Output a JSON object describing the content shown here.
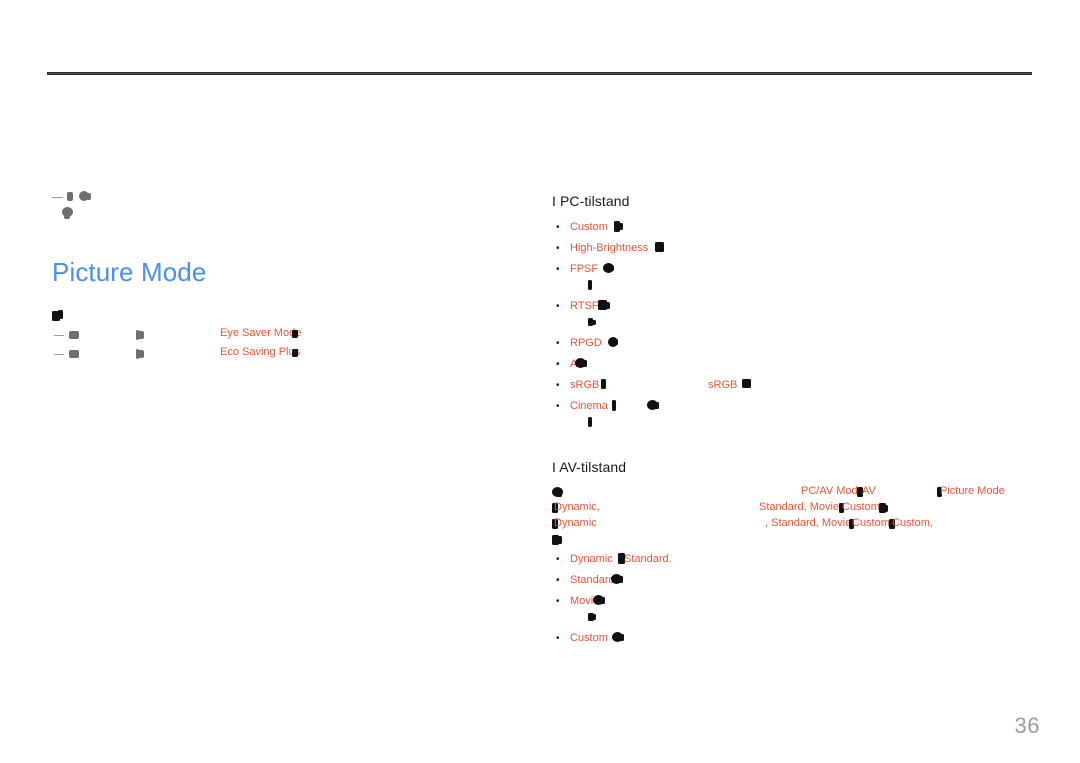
{
  "document": {
    "page_number": "36",
    "title": "Picture Mode",
    "title_color": "#4a8ef0",
    "term_color": "#e8543a",
    "heading_color": "#1a1a1a",
    "page_number_color": "#9b9b9b"
  },
  "left_column": {
    "title": "Picture Mode",
    "option_rows": [
      {
        "term": "Eye Saver Mode"
      },
      {
        "term": "Eco Saving Plus"
      }
    ]
  },
  "right_column": {
    "pc_section": {
      "heading": "I PC-tilstand",
      "bullets": [
        {
          "term": "Custom",
          "has_continuation": false
        },
        {
          "term": "High-Brightness",
          "has_continuation": false
        },
        {
          "term": "FPSF",
          "has_continuation": true
        },
        {
          "term": "RTSF",
          "has_continuation": true
        },
        {
          "term": "RPGD",
          "has_continuation": false
        },
        {
          "term": "AO",
          "has_continuation": false
        },
        {
          "term": "sRGB",
          "second_term": "sRGB",
          "has_continuation": false
        },
        {
          "term": "Cinema",
          "has_continuation": true
        }
      ]
    },
    "av_section": {
      "heading": "I AV-tilstand",
      "paragraph_terms": {
        "line1_right": "PC/AV Mode",
        "line1_right2": "AV",
        "line1_far_right": "Picture Mode",
        "line2_left": "Dynamic,",
        "line2_mid": "Standard, Movie",
        "line2_mid2": "Custom",
        "line3_left": "Dynamic",
        "line3_mid": ", Standard, Movie",
        "line3_mid2": "Custom",
        "line3_mid3": "Custom,"
      },
      "bullets": [
        {
          "term": "Dynamic",
          "term2": "Standard.",
          "has_continuation": false
        },
        {
          "term": "Standard",
          "has_continuation": false
        },
        {
          "term": "Movie",
          "has_continuation": true
        },
        {
          "term": "Custom",
          "has_continuation": false
        }
      ]
    }
  }
}
